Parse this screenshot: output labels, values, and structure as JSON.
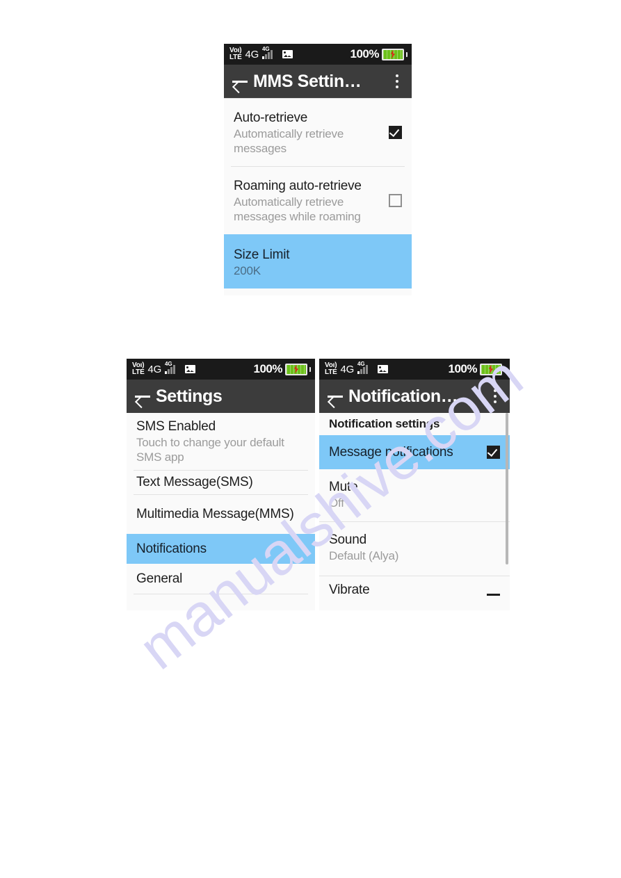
{
  "page": {
    "watermark": "manualshive.com",
    "background": "#ffffff"
  },
  "colors": {
    "accent_selected": "#7ec8f7",
    "appbar": "#3c3c3c",
    "statusbar": "#1a1a1a",
    "battery_fill": "#6cc11a",
    "battery_bolt": "#e31d1a",
    "list_bg": "#fafafa",
    "subtitle": "#9b9b9b"
  },
  "status_bar": {
    "volte_line1": "Voı)",
    "volte_line2": "LTE",
    "network": "4G",
    "signal_label": "4G",
    "battery_percent": "100%",
    "icons": [
      "volte-icon",
      "signal-bars-icon",
      "picture-icon",
      "battery-icon"
    ]
  },
  "screens": [
    {
      "id": "mms-settings",
      "appbar": {
        "title": "MMS Settin…",
        "back_label": "back-arrow",
        "has_overflow": true
      },
      "rows": [
        {
          "title": "Auto-retrieve",
          "subtitle": "Automatically retrieve messages",
          "checkbox": "checked",
          "selected": false
        },
        {
          "title": "Roaming auto-retrieve",
          "subtitle": "Automatically retrieve messages while roaming",
          "checkbox": "unchecked",
          "selected": false
        },
        {
          "title": "Size Limit",
          "subtitle": "200K",
          "checkbox": "none",
          "selected": true
        }
      ]
    },
    {
      "id": "settings",
      "appbar": {
        "title": "Settings",
        "back_label": "back-arrow",
        "has_overflow": false
      },
      "rows": [
        {
          "title": "SMS Enabled",
          "subtitle": "Touch to change your default SMS app",
          "checkbox": "none",
          "selected": false
        },
        {
          "title": "Text Message(SMS)",
          "subtitle": "",
          "checkbox": "none",
          "selected": false
        },
        {
          "title": "Multimedia Message(MMS)",
          "subtitle": "",
          "checkbox": "none",
          "selected": false
        },
        {
          "title": "Notifications",
          "subtitle": "",
          "checkbox": "none",
          "selected": true
        },
        {
          "title": "General",
          "subtitle": "",
          "checkbox": "none",
          "selected": false
        }
      ]
    },
    {
      "id": "notification-settings",
      "appbar": {
        "title": "Notification…",
        "back_label": "back-arrow",
        "has_overflow": true
      },
      "section_header": "Notification settings",
      "rows": [
        {
          "title": "Message notifications",
          "subtitle": "",
          "checkbox": "checked",
          "selected": true
        },
        {
          "title": "Mute",
          "subtitle": "Off",
          "checkbox": "none",
          "selected": false
        },
        {
          "title": "Sound",
          "subtitle": "Default (Alya)",
          "checkbox": "none",
          "selected": false
        },
        {
          "title": "Vibrate",
          "subtitle": "",
          "checkbox": "partial",
          "selected": false
        }
      ],
      "has_scrollbar": true
    }
  ]
}
